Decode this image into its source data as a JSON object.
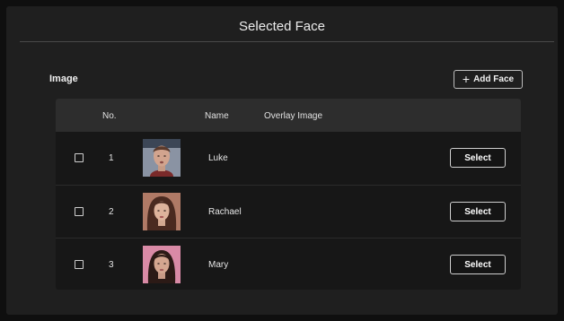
{
  "header": {
    "title": "Selected Face"
  },
  "section": {
    "label": "Image"
  },
  "toolbar": {
    "add_face_icon": "plus-icon",
    "add_face_label": "Add Face"
  },
  "table": {
    "columns": {
      "no": "No.",
      "name": "Name",
      "overlay": "Overlay Image"
    },
    "rows": [
      {
        "no": "1",
        "name": "Luke",
        "action": "Select"
      },
      {
        "no": "2",
        "name": "Rachael",
        "action": "Select"
      },
      {
        "no": "3",
        "name": "Mary",
        "action": "Select"
      }
    ]
  },
  "colors": {
    "background": "#0f0f0f",
    "panel": "#1f1f1f",
    "table_body": "#171717",
    "table_header": "#2d2d2d",
    "text": "#e6e6e6"
  }
}
